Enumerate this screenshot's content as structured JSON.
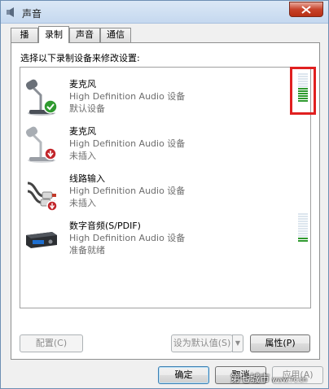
{
  "window": {
    "title": "声音"
  },
  "tabs": [
    {
      "label": "播放",
      "active": false
    },
    {
      "label": "录制",
      "active": true
    },
    {
      "label": "声音",
      "active": false
    },
    {
      "label": "通信",
      "active": false
    }
  ],
  "instruction": "选择以下录制设备来修改设置:",
  "devices": [
    {
      "name": "麦克风",
      "driver": "High Definition Audio 设备",
      "status": "默认设备",
      "icon": "microphone-default-icon",
      "meter_level": 0.5
    },
    {
      "name": "麦克风",
      "driver": "High Definition Audio 设备",
      "status": "未插入",
      "icon": "microphone-unplugged-icon"
    },
    {
      "name": "线路输入",
      "driver": "High Definition Audio 设备",
      "status": "未插入",
      "icon": "line-in-unplugged-icon"
    },
    {
      "name": "数字音频(S/PDIF)",
      "driver": "High Definition Audio 设备",
      "status": "准备就绪",
      "icon": "digital-audio-icon",
      "meter_level": 0.2
    }
  ],
  "buttons": {
    "configure": "配置(C)",
    "set_default": "设为默认值(S)",
    "properties": "属性(P)",
    "ok": "确定",
    "cancel": "取消",
    "apply": "应用(A)"
  },
  "watermark": {
    "text": "第七城市",
    "url": "www.7c.cn"
  },
  "colors": {
    "meter_on": "#2e9a2e",
    "highlight": "#e02020",
    "close_button": "#c7432a"
  }
}
